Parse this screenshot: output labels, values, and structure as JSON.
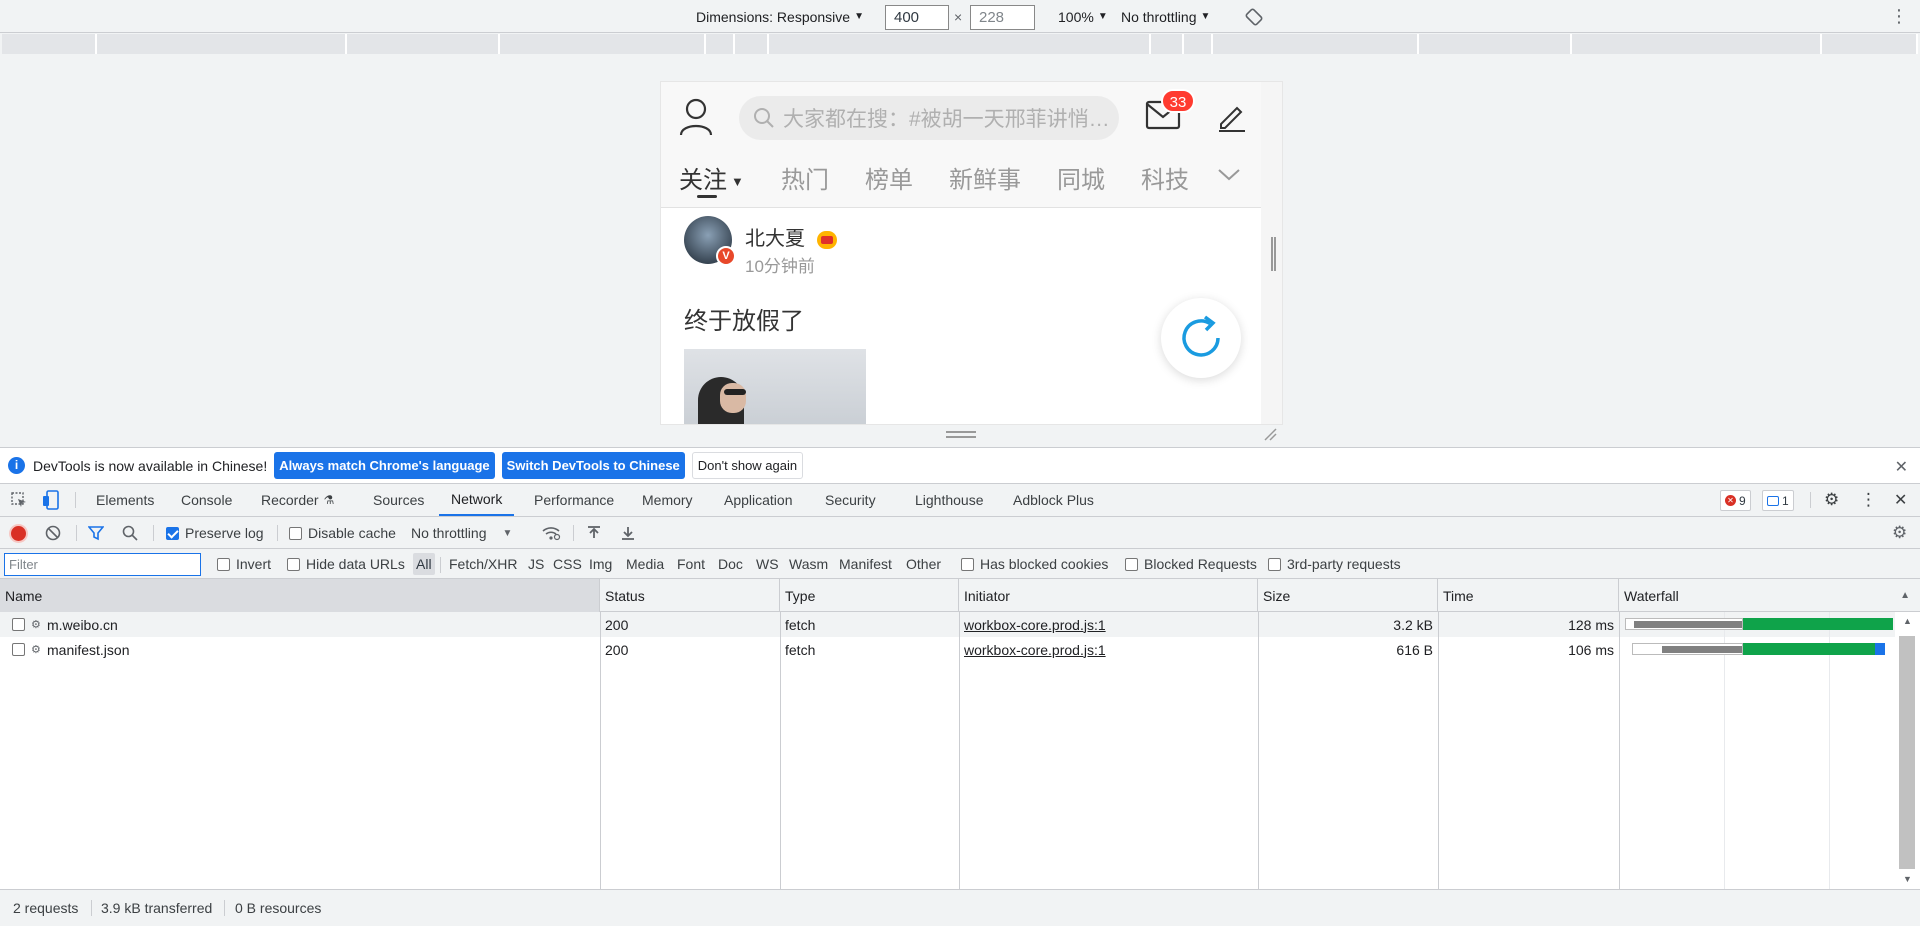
{
  "device_toolbar": {
    "dimensions_label": "Dimensions: Responsive",
    "width_value": "400",
    "times": "×",
    "height_value": "228",
    "zoom": "100%",
    "throttling": "No throttling"
  },
  "weibo": {
    "search_placeholder": "大家都在搜：#被胡一天邢菲讲悄…",
    "badge_count": "33",
    "tabs": [
      "关注",
      "热门",
      "榜单",
      "新鲜事",
      "同城",
      "科技"
    ],
    "post": {
      "author": "北大夏",
      "time": "10分钟前",
      "text": "终于放假了",
      "verified_mark": "V"
    }
  },
  "infobar": {
    "message": "DevTools is now available in Chinese!",
    "btn_match": "Always match Chrome's language",
    "btn_switch": "Switch DevTools to Chinese",
    "btn_dismiss": "Don't show again"
  },
  "devtools_tabs": {
    "items": [
      "Elements",
      "Console",
      "Recorder",
      "Sources",
      "Network",
      "Performance",
      "Memory",
      "Application",
      "Security",
      "Lighthouse",
      "Adblock Plus"
    ],
    "active": "Network",
    "error_count": "9",
    "message_count": "1"
  },
  "network_toolbar": {
    "preserve_log": "Preserve log",
    "disable_cache": "Disable cache",
    "throttling": "No throttling"
  },
  "filter_bar": {
    "placeholder": "Filter",
    "invert": "Invert",
    "hide_data_urls": "Hide data URLs",
    "types": [
      "All",
      "Fetch/XHR",
      "JS",
      "CSS",
      "Img",
      "Media",
      "Font",
      "Doc",
      "WS",
      "Wasm",
      "Manifest",
      "Other"
    ],
    "has_blocked_cookies": "Has blocked cookies",
    "blocked_requests": "Blocked Requests",
    "third_party": "3rd-party requests"
  },
  "table": {
    "columns": [
      "Name",
      "Status",
      "Type",
      "Initiator",
      "Size",
      "Time",
      "Waterfall"
    ],
    "rows": [
      {
        "name": "m.weibo.cn",
        "status": "200",
        "type": "fetch",
        "initiator": "workbox-core.prod.js:1",
        "size": "3.2 kB",
        "time": "128 ms"
      },
      {
        "name": "manifest.json",
        "status": "200",
        "type": "fetch",
        "initiator": "workbox-core.prod.js:1",
        "size": "616 B",
        "time": "106 ms"
      }
    ]
  },
  "status_bar": {
    "requests": "2 requests",
    "transferred": "3.9 kB transferred",
    "resources": "0 B resources"
  },
  "colors": {
    "accent": "#1a73e8",
    "badge": "#ff3b30",
    "waterfall_green": "#0fa34a",
    "waterfall_blue": "#1a73e8",
    "record_red": "#d93025"
  }
}
